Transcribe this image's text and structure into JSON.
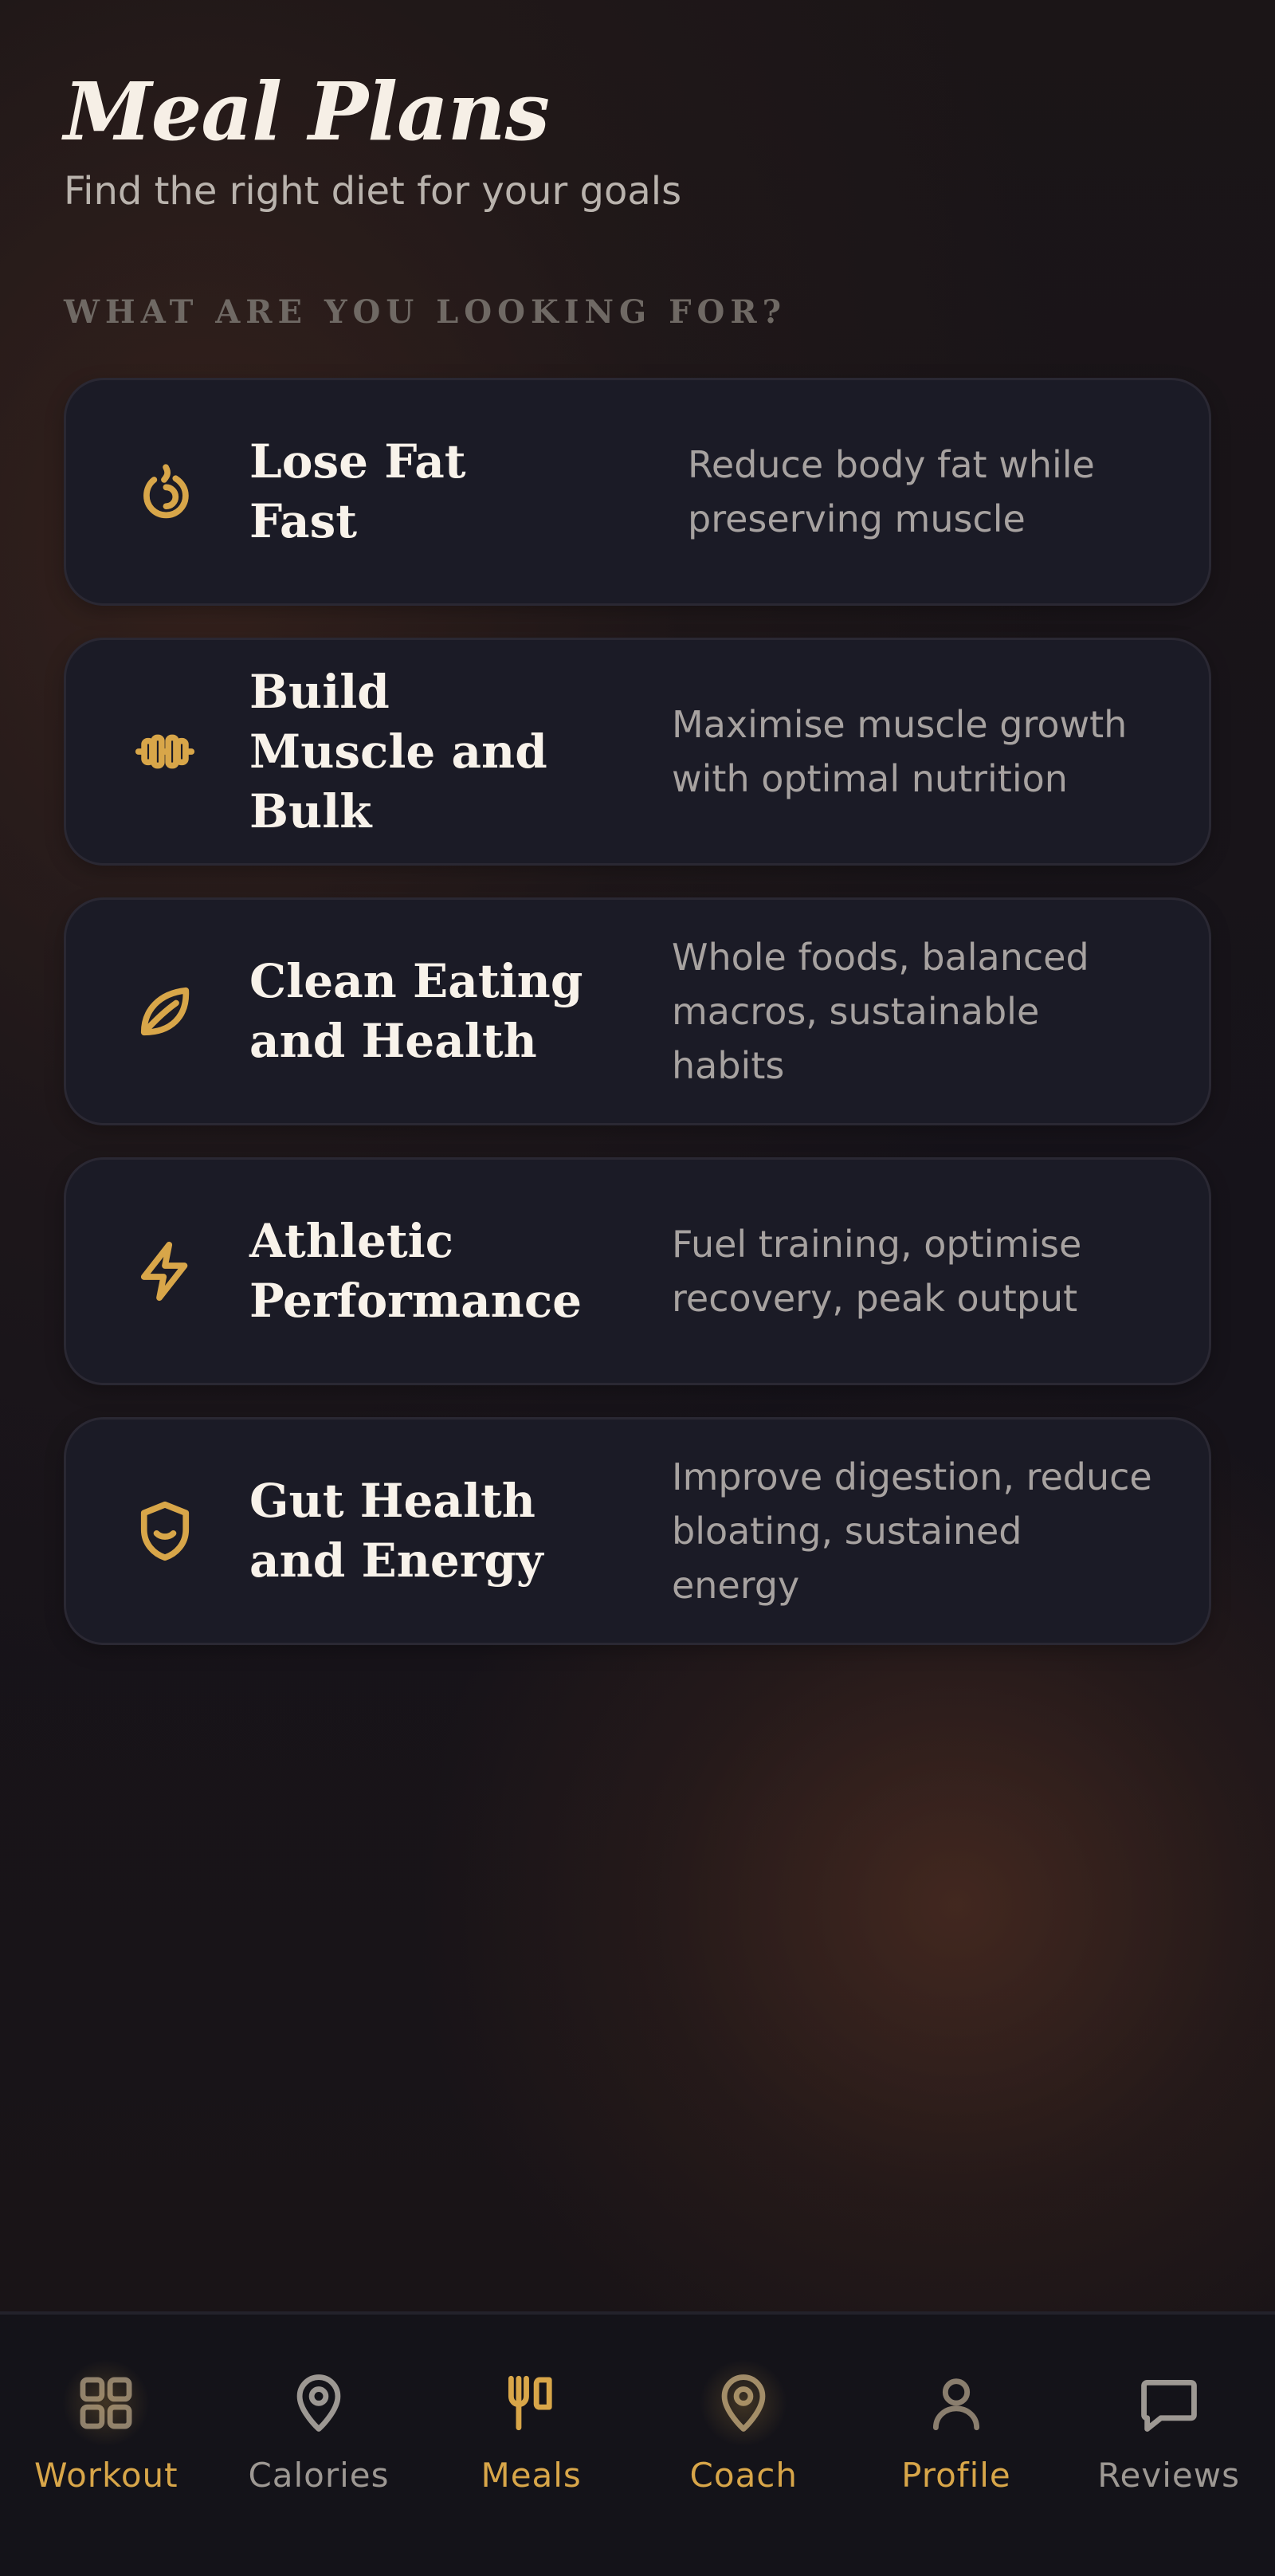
{
  "header": {
    "title": "Meal Plans",
    "subtitle": "Find the right diet for your goals"
  },
  "section": {
    "label": "WHAT ARE YOU LOOKING FOR?"
  },
  "goals": [
    {
      "icon": "flame-icon",
      "title": "Lose Fat Fast",
      "description": "Reduce body fat while preserving muscle"
    },
    {
      "icon": "dumbbell-icon",
      "title": "Build Muscle and Bulk",
      "description": "Maximise muscle growth with optimal nutrition"
    },
    {
      "icon": "leaf-icon",
      "title": "Clean Eating and Health",
      "description": "Whole foods, balanced macros, sustainable habits"
    },
    {
      "icon": "lightning-icon",
      "title": "Athletic Performance",
      "description": "Fuel training, optimise recovery, peak output"
    },
    {
      "icon": "shield-smile-icon",
      "title": "Gut Health and Energy",
      "description": "Improve digestion, reduce bloating, sustained energy"
    }
  ],
  "nav": {
    "items": [
      {
        "icon": "grid-icon",
        "label": "Workout",
        "state": "gold"
      },
      {
        "icon": "map-pin-icon",
        "label": "Calories",
        "state": "grey"
      },
      {
        "icon": "fork-knife-icon",
        "label": "Meals",
        "state": "active"
      },
      {
        "icon": "map-pin-icon",
        "label": "Coach",
        "state": "gold"
      },
      {
        "icon": "user-icon",
        "label": "Profile",
        "state": "gold"
      },
      {
        "icon": "chat-icon",
        "label": "Reviews",
        "state": "grey"
      }
    ]
  },
  "colors": {
    "accent": "#d8a649",
    "card_bg": "#1b1b26",
    "text_primary": "#f8f2ea",
    "text_secondary": "#a7a2a0"
  }
}
